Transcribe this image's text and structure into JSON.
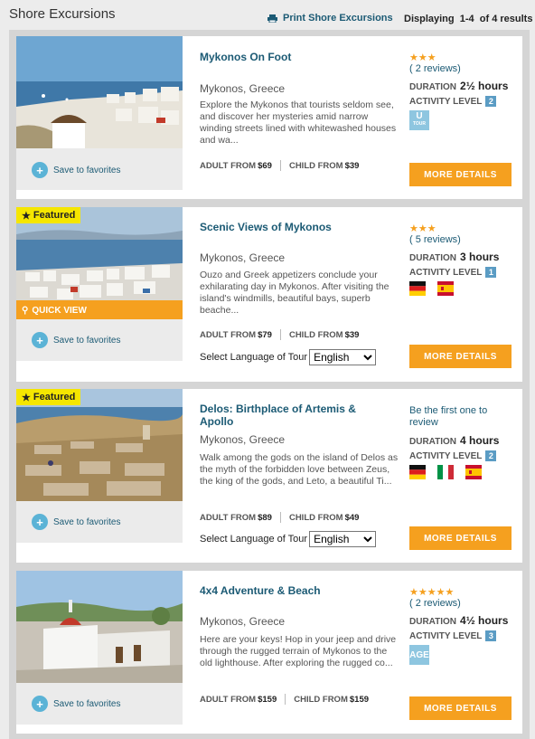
{
  "header": {
    "title": "Shore Excursions",
    "print_label": "Print Shore Excursions",
    "displaying_label": "Displaying",
    "range": "1-4",
    "of_label": "of 4 results"
  },
  "labels": {
    "save_favorites": "Save to favorites",
    "featured": "Featured",
    "quick_view": "QUICK VIEW",
    "duration": "DURATION",
    "activity_level": "ACTIVITY LEVEL",
    "adult_from": "ADULT FROM",
    "child_from": "CHILD FROM",
    "select_language": "Select Language of Tour",
    "more_details": "MORE DETAILS",
    "first_review": "Be the first one to review"
  },
  "excursions": [
    {
      "title": "Mykonos On Foot",
      "location": "Mykonos, Greece",
      "description": "Explore the Mykonos that tourists seldom see, and discover her mysteries amid narrow winding streets lined with whitewashed houses and wa...",
      "adult_price": "$69",
      "child_price": "$39",
      "stars": "★★★",
      "reviews": "( 2 reviews)",
      "duration": "2½ hours",
      "activity_level": "2",
      "badge": "U TOUR",
      "badge_main": "U",
      "badge_sub": "TOUR"
    },
    {
      "title": "Scenic Views of Mykonos",
      "location": "Mykonos, Greece",
      "description": "Ouzo and Greek appetizers conclude your exhilarating day in Mykonos. After visiting the island's windmills, beautiful bays, superb beache...",
      "adult_price": "$79",
      "child_price": "$39",
      "stars": "★★★",
      "reviews": "( 5 reviews)",
      "duration": "3 hours",
      "activity_level": "1",
      "language": "English",
      "flags": [
        "german-flag-icon",
        "spanish-flag-icon"
      ]
    },
    {
      "title": "Delos: Birthplace of Artemis & Apollo",
      "location": "Mykonos, Greece",
      "description": "Walk among the gods on the island of Delos as the myth of the forbidden love between Zeus, the king of the gods, and Leto, a beautiful Ti...",
      "adult_price": "$89",
      "child_price": "$49",
      "duration": "4 hours",
      "activity_level": "2",
      "language": "English",
      "flags": [
        "german-flag-icon",
        "italian-flag-icon",
        "spanish-flag-icon"
      ]
    },
    {
      "title": "4x4 Adventure & Beach",
      "location": "Mykonos, Greece",
      "description": "Here are your keys! Hop in your jeep and drive through the rugged terrain of Mykonos to the old lighthouse. After exploring the rugged co...",
      "adult_price": "$159",
      "child_price": "$159",
      "stars": "★★★★★",
      "reviews": "( 2 reviews)",
      "duration": "4½ hours",
      "activity_level": "3",
      "badge": "AGE"
    }
  ],
  "colors": {
    "accent_orange": "#f5a01f",
    "link_blue": "#1b5a74",
    "featured_yellow": "#f5e600"
  }
}
